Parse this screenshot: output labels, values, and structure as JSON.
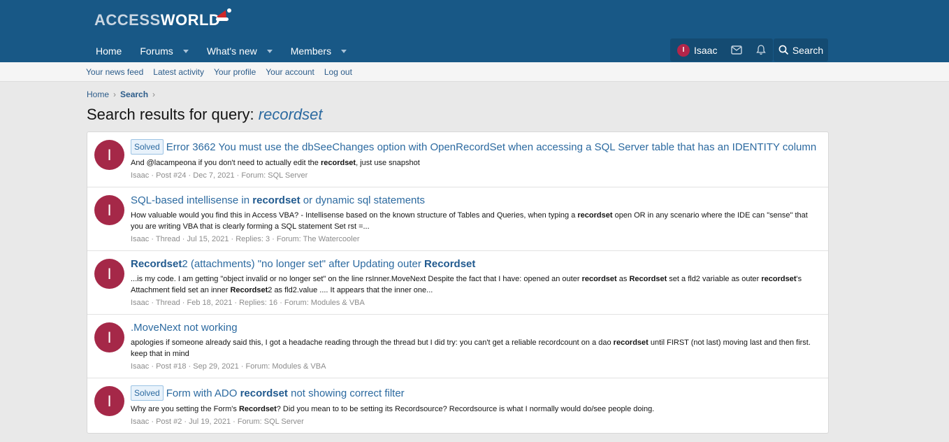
{
  "logo": {
    "part1": "ACCESS",
    "part2": "WORLD"
  },
  "nav": [
    {
      "label": "Home",
      "has_caret": false
    },
    {
      "label": "Forums",
      "has_caret": true
    },
    {
      "label": "What's new",
      "has_caret": true
    },
    {
      "label": "Members",
      "has_caret": true
    }
  ],
  "user": {
    "initial": "I",
    "name": "Isaac"
  },
  "search_label": "Search",
  "subnav": [
    "Your news feed",
    "Latest activity",
    "Your profile",
    "Your account",
    "Log out"
  ],
  "breadcrumb": {
    "home": "Home",
    "current": "Search"
  },
  "page_title": {
    "prefix": "Search results for query: ",
    "query": "recordset"
  },
  "results": [
    {
      "badge": "Solved",
      "title_html": "Error 3662 You must use the dbSeeChanges option with OpenRecordSet when accessing a SQL Server table that has an IDENTITY column",
      "snippet_html": "And @lacampeona if you don't need to actually edit the <b>recordset</b>, just use snapshot",
      "meta": "Isaac · Post #24 · Dec 7, 2021 · Forum: SQL Server"
    },
    {
      "badge": "",
      "title_html": "SQL-based intellisense in <b>recordset</b> or dynamic sql statements",
      "snippet_html": "How valuable would you find this in Access VBA? - Intellisense based on the known structure of Tables and Queries, when typing a <b>recordset</b> open OR in any scenario where the IDE can \"sense\" that you are writing VBA that is clearly forming a SQL statement Set rst =...",
      "meta": "Isaac · Thread · Jul 15, 2021 · Replies: 3 · Forum: The Watercooler"
    },
    {
      "badge": "",
      "title_html": "<b>Recordset</b>2 (attachments) \"no longer set\" after Updating outer <b>Recordset</b>",
      "snippet_html": "...is my code. I am getting \"object invalid or no longer set\" on the line rsInner.MoveNext Despite the fact that I have: opened an outer <b>recordset</b> as <b>Recordset</b> set a fld2 variable as outer <b>recordset</b>'s Attachment field set an inner <b>Recordset</b>2 as fld2.value .... It appears that the inner one...",
      "meta": "Isaac · Thread · Feb 18, 2021 · Replies: 16 · Forum: Modules & VBA"
    },
    {
      "badge": "",
      "title_html": ".MoveNext not working",
      "snippet_html": "apologies if someone already said this, I got a headache reading through the thread but I did try: you can't get a reliable recordcount on a dao <b>recordset</b> until FIRST (not last) moving last and then first. keep that in mind",
      "meta": "Isaac · Post #18 · Sep 29, 2021 · Forum: Modules & VBA"
    },
    {
      "badge": "Solved",
      "title_html": "Form with ADO <b>recordset</b> not showing correct filter",
      "snippet_html": "Why are you setting the Form's <b>Recordset</b>? Did you mean to to be setting its Recordsource? Recordsource is what I normally would do/see people doing.",
      "meta": "Isaac · Post #2 · Jul 19, 2021 · Forum: SQL Server"
    }
  ]
}
